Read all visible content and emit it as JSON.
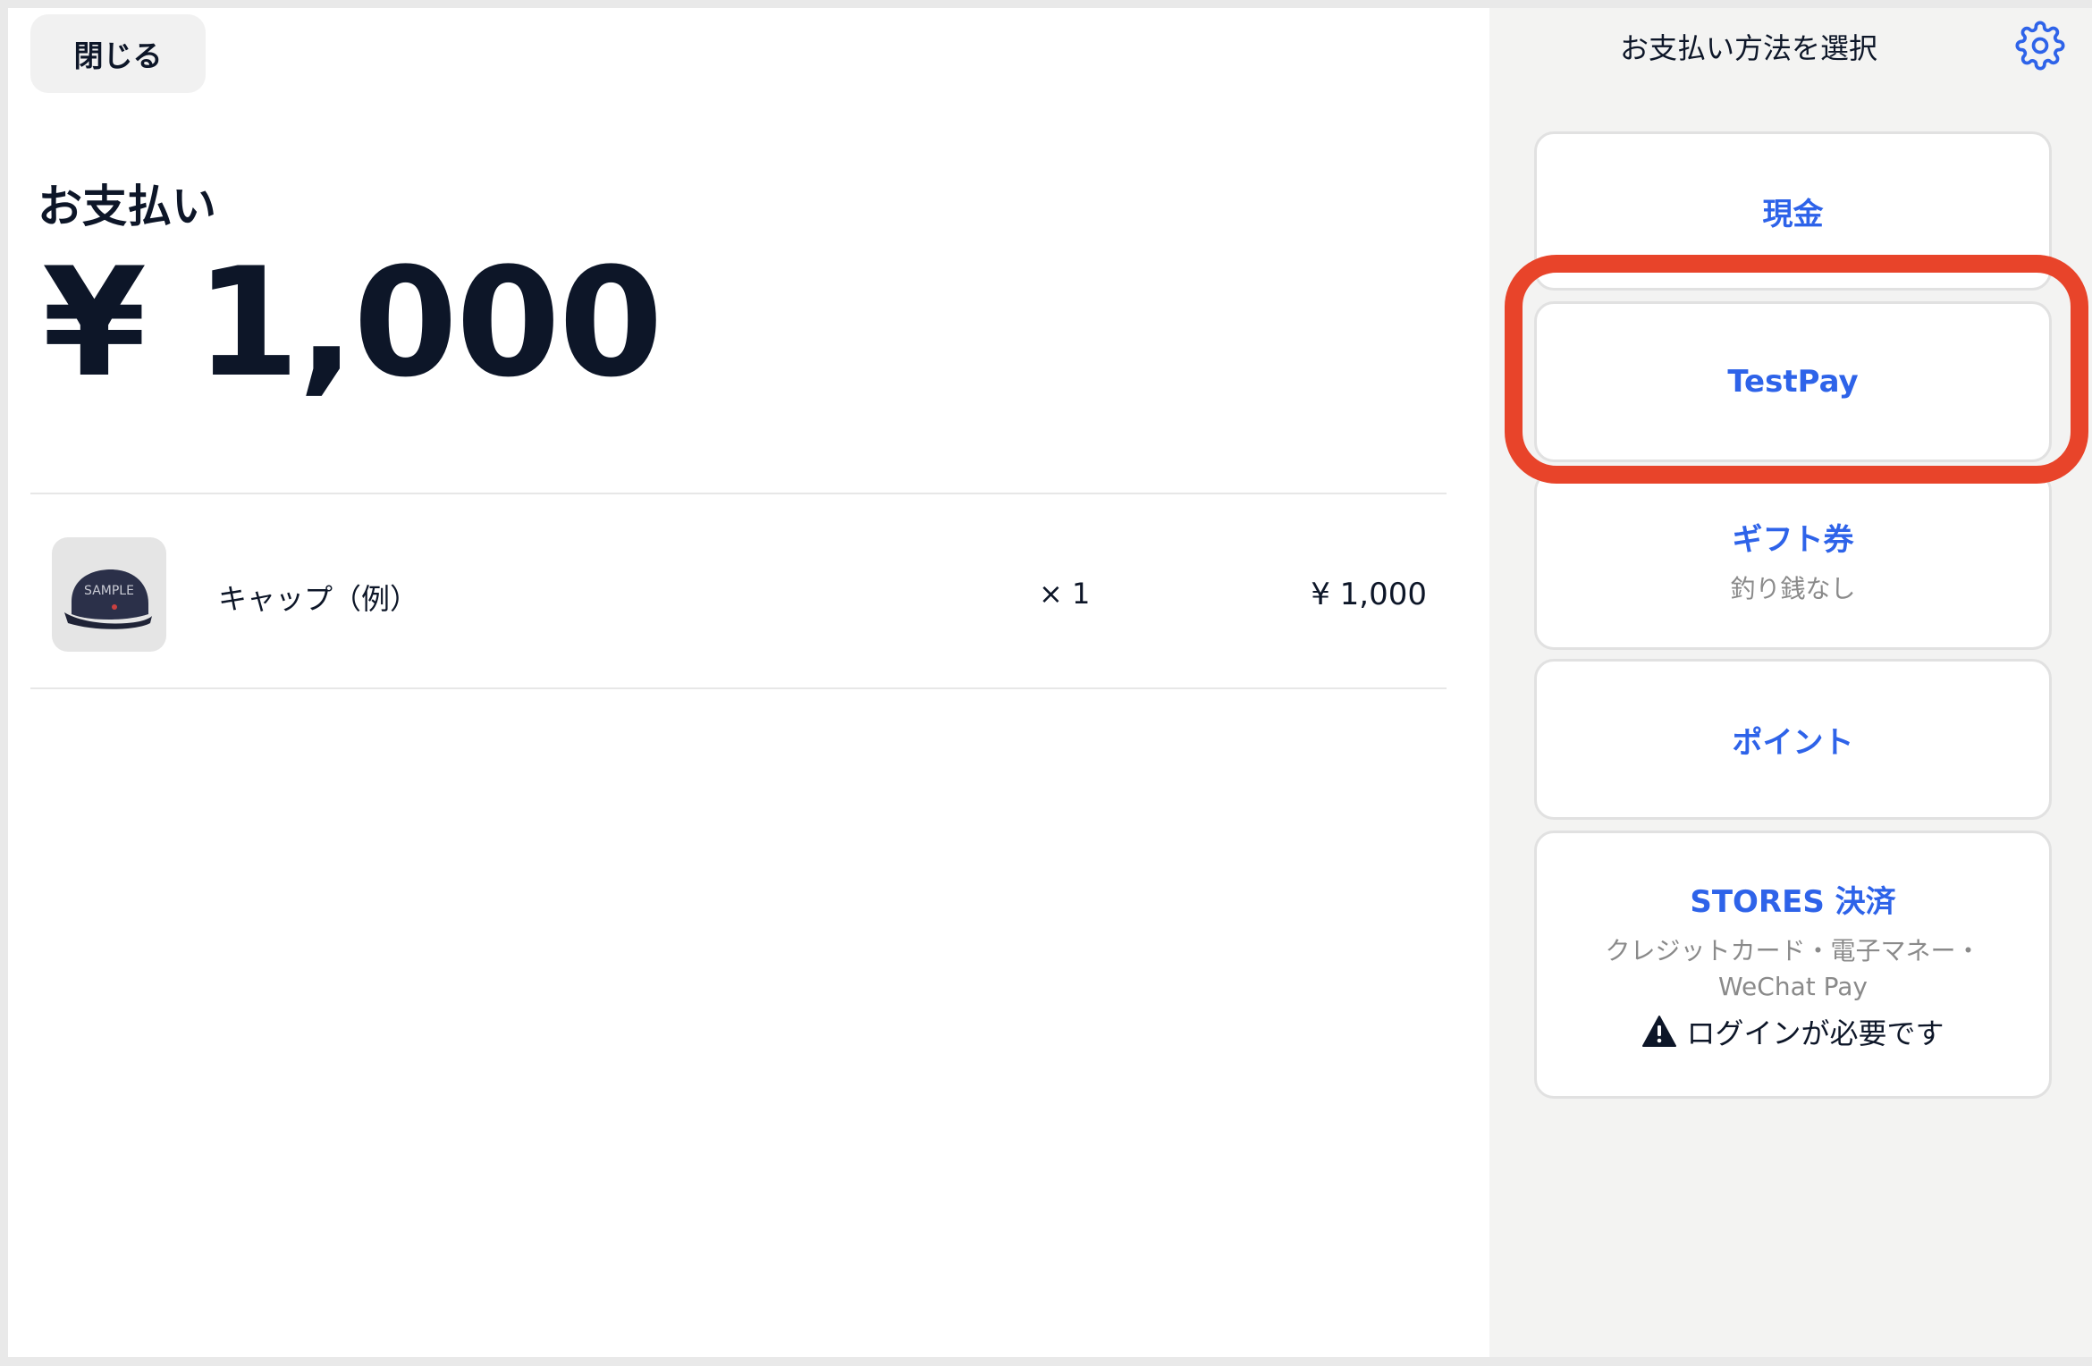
{
  "left": {
    "close_label": "閉じる",
    "payment_label": "お支払い",
    "amount": "¥ 1,000",
    "item": {
      "name": "キャップ（例）",
      "qty": "× 1",
      "price": "¥ 1,000",
      "thumb_watermark": "SAMPLE"
    }
  },
  "right": {
    "title": "お支払い方法を選択",
    "methods": [
      {
        "label": "現金",
        "sub": ""
      },
      {
        "label": "TestPay",
        "sub": ""
      },
      {
        "label": "ギフト券",
        "sub": "釣り銭なし"
      },
      {
        "label": "ポイント",
        "sub": ""
      },
      {
        "label": "STORES 決済",
        "sub_line1": "クレジットカード・電子マネー・",
        "sub_line2": "WeChat Pay",
        "warning": "ログインが必要です"
      }
    ]
  },
  "colors": {
    "accent": "#2e63e9",
    "highlight": "#e8442a",
    "text": "#0d1628",
    "muted": "#8a8a8a",
    "sidebar_bg": "#f3f3f2"
  },
  "icons": {
    "settings": "gear-icon",
    "warning": "warning-icon"
  }
}
